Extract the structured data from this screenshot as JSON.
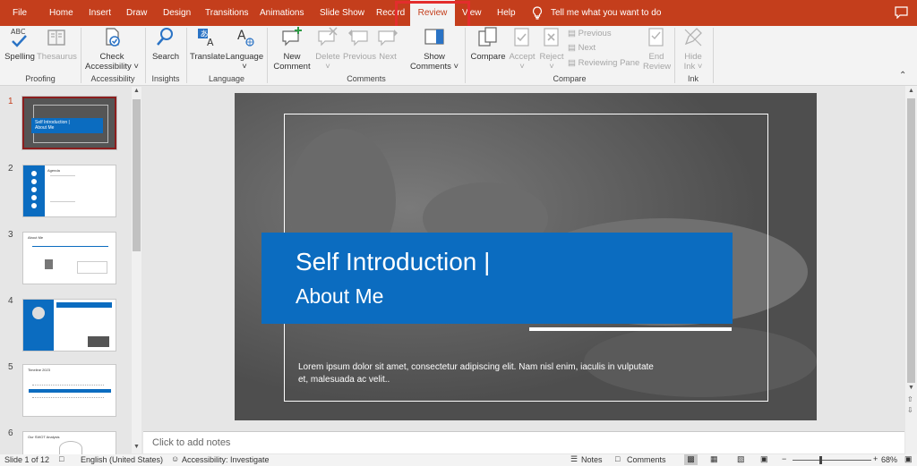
{
  "tabs": [
    {
      "label": "File",
      "active": false
    },
    {
      "label": "Home",
      "active": false
    },
    {
      "label": "Insert",
      "active": false
    },
    {
      "label": "Draw",
      "active": false
    },
    {
      "label": "Design",
      "active": false
    },
    {
      "label": "Transitions",
      "active": false
    },
    {
      "label": "Animations",
      "active": false
    },
    {
      "label": "Slide Show",
      "active": false
    },
    {
      "label": "Record",
      "active": false
    },
    {
      "label": "Review",
      "active": true
    },
    {
      "label": "View",
      "active": false
    },
    {
      "label": "Help",
      "active": false
    }
  ],
  "tell_me": "Tell me what you want to do",
  "colors": {
    "accent": "#c43e1c",
    "highlight_box": "#e32d2d",
    "title_band": "#0b6cc0",
    "selected_thumb": "#8b1e1e"
  },
  "ribbon": {
    "proofing": {
      "spelling": "Spelling",
      "thesaurus": "Thesaurus",
      "group": "Proofing",
      "spelling_icon_text": "ABC"
    },
    "accessibility": {
      "check_line1": "Check",
      "check_line2": "Accessibility",
      "group": "Accessibility"
    },
    "insights": {
      "search": "Search",
      "group": "Insights"
    },
    "language": {
      "translate": "Translate",
      "language": "Language",
      "group": "Language"
    },
    "comments": {
      "new_line1": "New",
      "new_line2": "Comment",
      "delete": "Delete",
      "previous": "Previous",
      "next": "Next",
      "show_line1": "Show",
      "show_line2": "Comments",
      "group": "Comments"
    },
    "compare": {
      "compare": "Compare",
      "accept": "Accept",
      "reject": "Reject",
      "previous": "Previous",
      "next": "Next",
      "reviewing_pane": "Reviewing Pane",
      "end_line1": "End",
      "end_line2": "Review",
      "group": "Compare"
    },
    "ink": {
      "hide_line1": "Hide",
      "hide_line2": "Ink",
      "group": "Ink"
    }
  },
  "thumbnails": [
    {
      "num": "1",
      "title": "Self Introduction |",
      "sub": "About Me"
    },
    {
      "num": "2",
      "title": "Agenda"
    },
    {
      "num": "3",
      "title": "About Me"
    },
    {
      "num": "4",
      "title": ""
    },
    {
      "num": "5",
      "title": "Timeline 2023"
    },
    {
      "num": "6",
      "title": "Our SWOT Analysis"
    }
  ],
  "slide": {
    "title_line1": "Self Introduction |",
    "title_line2": "About Me",
    "body": "Lorem ipsum dolor sit amet, consectetur adipiscing elit. Nam nisl enim, iaculis in vulputate et, malesuada ac velit.."
  },
  "notes_placeholder": "Click to add notes",
  "status": {
    "slide_counter": "Slide 1 of 12",
    "language": "English (United States)",
    "accessibility": "Accessibility: Investigate",
    "notes": "Notes",
    "comments": "Comments",
    "zoom": "68%",
    "zoom_level": 0.68
  }
}
